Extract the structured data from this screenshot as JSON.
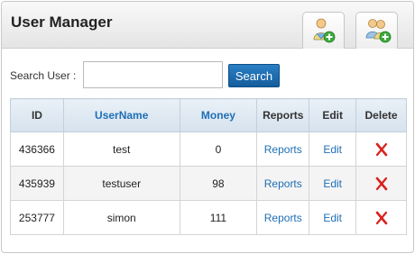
{
  "header": {
    "title": "User Manager",
    "buttons": [
      {
        "icon": "add-user-icon"
      },
      {
        "icon": "add-group-icon"
      }
    ]
  },
  "search": {
    "label": "Search User :",
    "value": "",
    "placeholder": "",
    "button_label": "Search"
  },
  "table": {
    "columns": [
      "ID",
      "UserName",
      "Money",
      "Reports",
      "Edit",
      "Delete"
    ],
    "rows": [
      {
        "id": "436366",
        "username": "test",
        "money": "0",
        "reports": "Reports",
        "edit": "Edit",
        "delete_icon": "delete-x-icon"
      },
      {
        "id": "435939",
        "username": "testuser",
        "money": "98",
        "reports": "Reports",
        "edit": "Edit",
        "delete_icon": "delete-x-icon"
      },
      {
        "id": "253777",
        "username": "simon",
        "money": "111",
        "reports": "Reports",
        "edit": "Edit",
        "delete_icon": "delete-x-icon"
      }
    ]
  },
  "colors": {
    "accent": "#1e6fb5",
    "button": "#1a6db3",
    "delete": "#d9221c"
  }
}
